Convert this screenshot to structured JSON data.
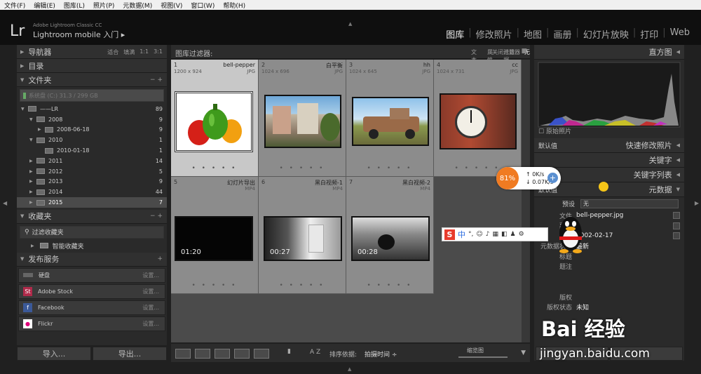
{
  "menu": [
    "文件(F)",
    "编辑(E)",
    "图库(L)",
    "照片(P)",
    "元数据(M)",
    "视图(V)",
    "窗口(W)",
    "帮助(H)"
  ],
  "identity": {
    "logo": "Lr",
    "small": "Adobe Lightroom Classic CC",
    "title": "Lightroom mobile 入门 ▸"
  },
  "modules": [
    "图库",
    "修改照片",
    "地图",
    "画册",
    "幻灯片放映",
    "打印",
    "Web"
  ],
  "left": {
    "navigator": {
      "label": "导航器",
      "opts": [
        "适合",
        "填满",
        "1:1",
        "3:1"
      ]
    },
    "catalog": {
      "label": "目录"
    },
    "folders": {
      "label": "文件夹",
      "volume": "系统盘 (C:)  31.3 / 299 GB",
      "items": [
        {
          "name": "——LR",
          "count": "89"
        },
        {
          "name": "2008",
          "count": "9"
        },
        {
          "name": "2008-06-18",
          "count": "9"
        },
        {
          "name": "2010",
          "count": "1"
        },
        {
          "name": "2010-01-18",
          "count": "1"
        },
        {
          "name": "2011",
          "count": "14"
        },
        {
          "name": "2012",
          "count": "5"
        },
        {
          "name": "2013",
          "count": "9"
        },
        {
          "name": "2014",
          "count": "44"
        },
        {
          "name": "2015",
          "count": "7"
        }
      ]
    },
    "collections": {
      "label": "收藏夹",
      "search": "过滤收藏夹",
      "smart": "智能收藏夹"
    },
    "publish": {
      "label": "发布服务",
      "setting": "设置...",
      "services": [
        "硬盘",
        "Adobe Stock",
        "Facebook",
        "Flickr"
      ]
    },
    "import": "导入...",
    "export": "导出..."
  },
  "filter": {
    "title": "图库过滤器:",
    "options": [
      "文本",
      "属性",
      "元数据",
      "无"
    ],
    "close": "关闭过滤器"
  },
  "grid": [
    {
      "num": "1",
      "name": "bell-pepper",
      "dim": "1200 x 924",
      "ext": "JPG"
    },
    {
      "num": "2",
      "name": "白平衡",
      "dim": "1024 x 696",
      "ext": "JPG"
    },
    {
      "num": "3",
      "name": "hh",
      "dim": "1024 x 645",
      "ext": "JPG"
    },
    {
      "num": "4",
      "name": "cc",
      "dim": "1024 x 731",
      "ext": "JPG"
    },
    {
      "num": "5",
      "name": "幻灯片导出",
      "dim": "",
      "ext": "MP4",
      "dur": "01:20"
    },
    {
      "num": "6",
      "name": "黑白视频-1",
      "dim": "",
      "ext": "MP4",
      "dur": "00:27"
    },
    {
      "num": "7",
      "name": "黑白视频-2",
      "dim": "",
      "ext": "MP4",
      "dur": "00:28"
    }
  ],
  "toolbar": {
    "sort_label": "排序依据:",
    "sort_value": "拍摄时间 ÷",
    "thumb_label": "缩览图"
  },
  "right": {
    "histogram": "直方图",
    "original": "原始照片",
    "quick_dev": {
      "label": "快速修改照片",
      "preset": "默认值"
    },
    "keywording": "关键字",
    "keyword_list": "关键字列表",
    "metadata": {
      "label": "元数据",
      "preset": "默认值"
    },
    "preset_label": "预设",
    "preset_value": "无",
    "fields": [
      {
        "label": "文件",
        "value": "bell-pepper.jpg"
      },
      {
        "label": "副本",
        "value": ""
      },
      {
        "label": "",
        "value": "2002-02-17"
      },
      {
        "label": "元数据状态",
        "value": "最新"
      },
      {
        "label": "标题",
        "value": ""
      },
      {
        "label": "题注",
        "value": ""
      },
      {
        "label": "",
        "value": ""
      },
      {
        "label": "",
        "value": ""
      },
      {
        "label": "版权",
        "value": ""
      },
      {
        "label": "版权状态",
        "value": "未知"
      },
      {
        "label": "",
        "value": ""
      },
      {
        "label": "",
        "value": ""
      }
    ]
  },
  "speed": {
    "percent": "81%",
    "up": "0K/s",
    "down": "0.07K/s"
  },
  "ime": {
    "zh": "中",
    "punct": "°,"
  },
  "watermark": {
    "top": "Bai 经验",
    "bottom": "jingyan.baidu.com"
  }
}
